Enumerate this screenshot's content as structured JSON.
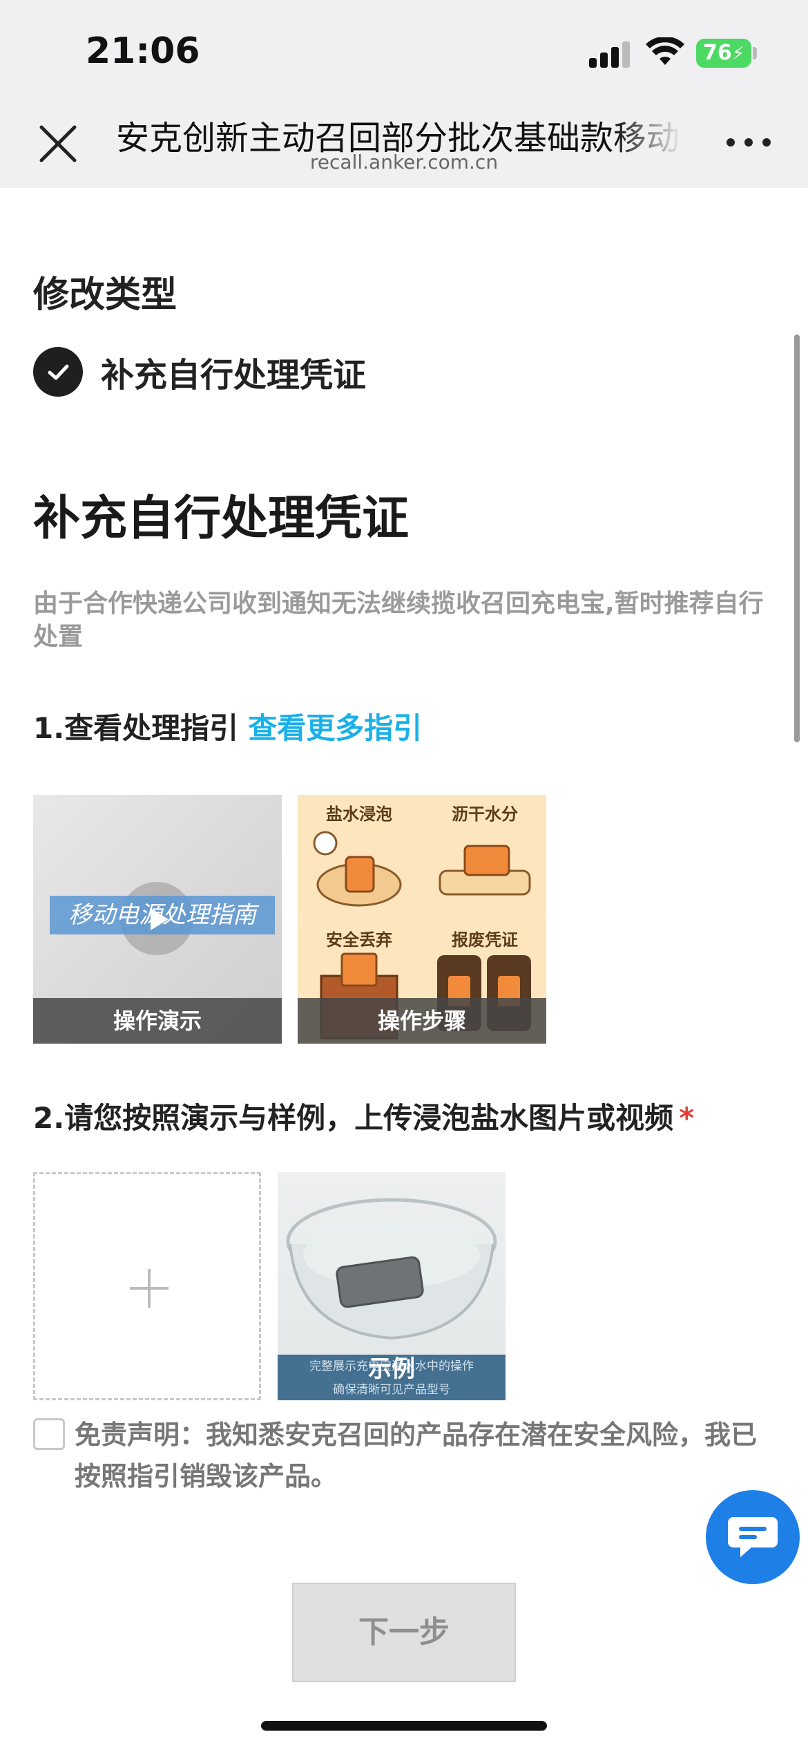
{
  "status_bar": {
    "time": "21:06",
    "battery": "76"
  },
  "nav": {
    "title": "安克创新主动召回部分批次基础款移动电源",
    "url": "recall.anker.com.cn"
  },
  "form": {
    "modify_type_label": "修改类型",
    "selected_type": "补充自行处理凭证",
    "page_title": "补充自行处理凭证",
    "description": "由于合作快递公司收到通知无法继续揽收召回充电宝,暂时推荐自行处置",
    "step1": {
      "label": "1.查看处理指引",
      "link": "查看更多指引"
    },
    "guides": {
      "video": {
        "banner": "移动电源处理指南",
        "caption": "操作演示"
      },
      "steps": {
        "caption": "操作步骤",
        "panels": [
          "盐水浸泡",
          "沥干水分",
          "安全丢弃",
          "报废凭证"
        ]
      }
    },
    "step2": {
      "label": "2.请您按照演示与样例，上传浸泡盐水图片或视频",
      "required_mark": "*"
    },
    "sample": {
      "hint1": "完整展示充电宝浸入水中的操作",
      "hint2": "确保清晰可见产品型号",
      "label": "示例"
    },
    "disclaimer": "免责声明：我知悉安克召回的产品存在潜在安全风险，我已按照指引销毁该产品。",
    "next_button": "下一步"
  }
}
